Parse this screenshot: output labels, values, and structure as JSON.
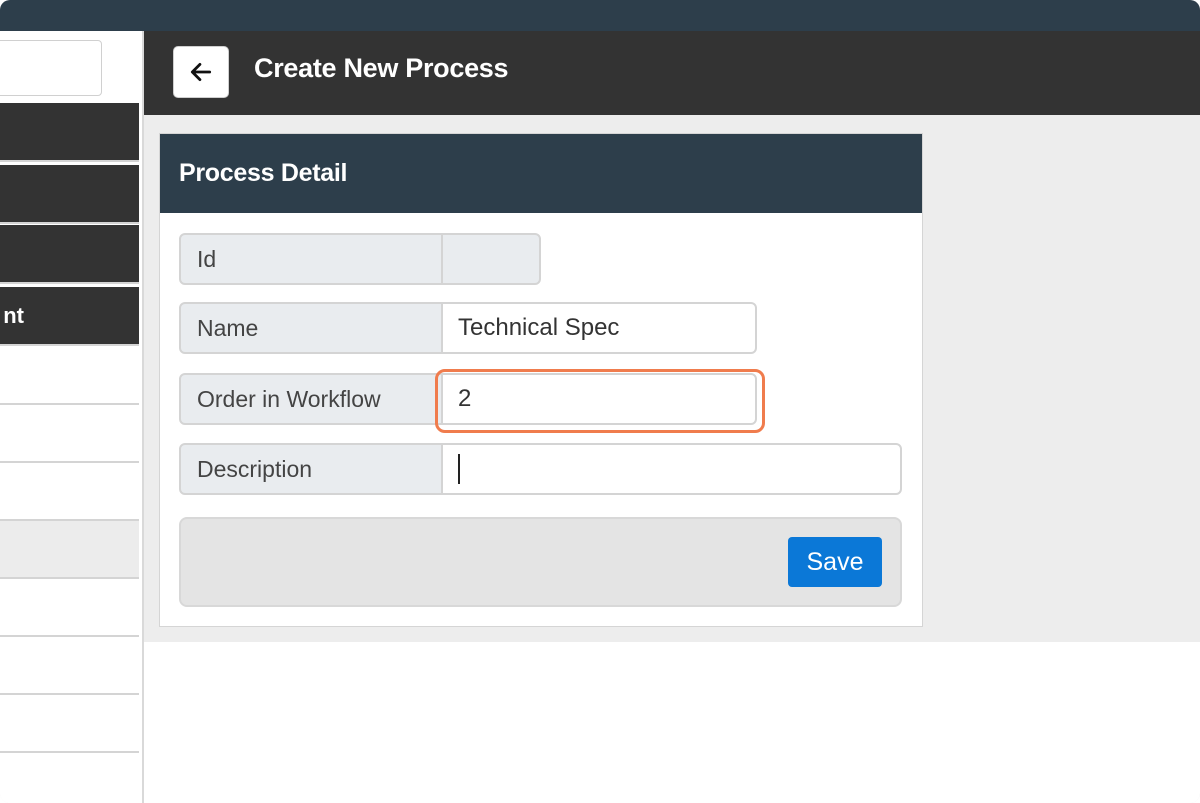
{
  "header": {
    "title": "Create New Process"
  },
  "sidebar": {
    "items": [
      {
        "label": ""
      },
      {
        "label": ""
      },
      {
        "label": ""
      },
      {
        "label": "nt"
      }
    ]
  },
  "panel": {
    "title": "Process Detail",
    "fields": [
      {
        "label": "Id",
        "value": ""
      },
      {
        "label": "Name",
        "value": "Technical Spec"
      },
      {
        "label": "Order in Workflow",
        "value": "2"
      },
      {
        "label": "Description",
        "value": ""
      }
    ],
    "save_label": "Save"
  },
  "colors": {
    "accent": "#0b78d7",
    "highlight": "#f07c4d",
    "header_dark": "#333333",
    "panel_header": "#2d3e4b"
  },
  "icons": {
    "back": "arrow-left-icon"
  }
}
